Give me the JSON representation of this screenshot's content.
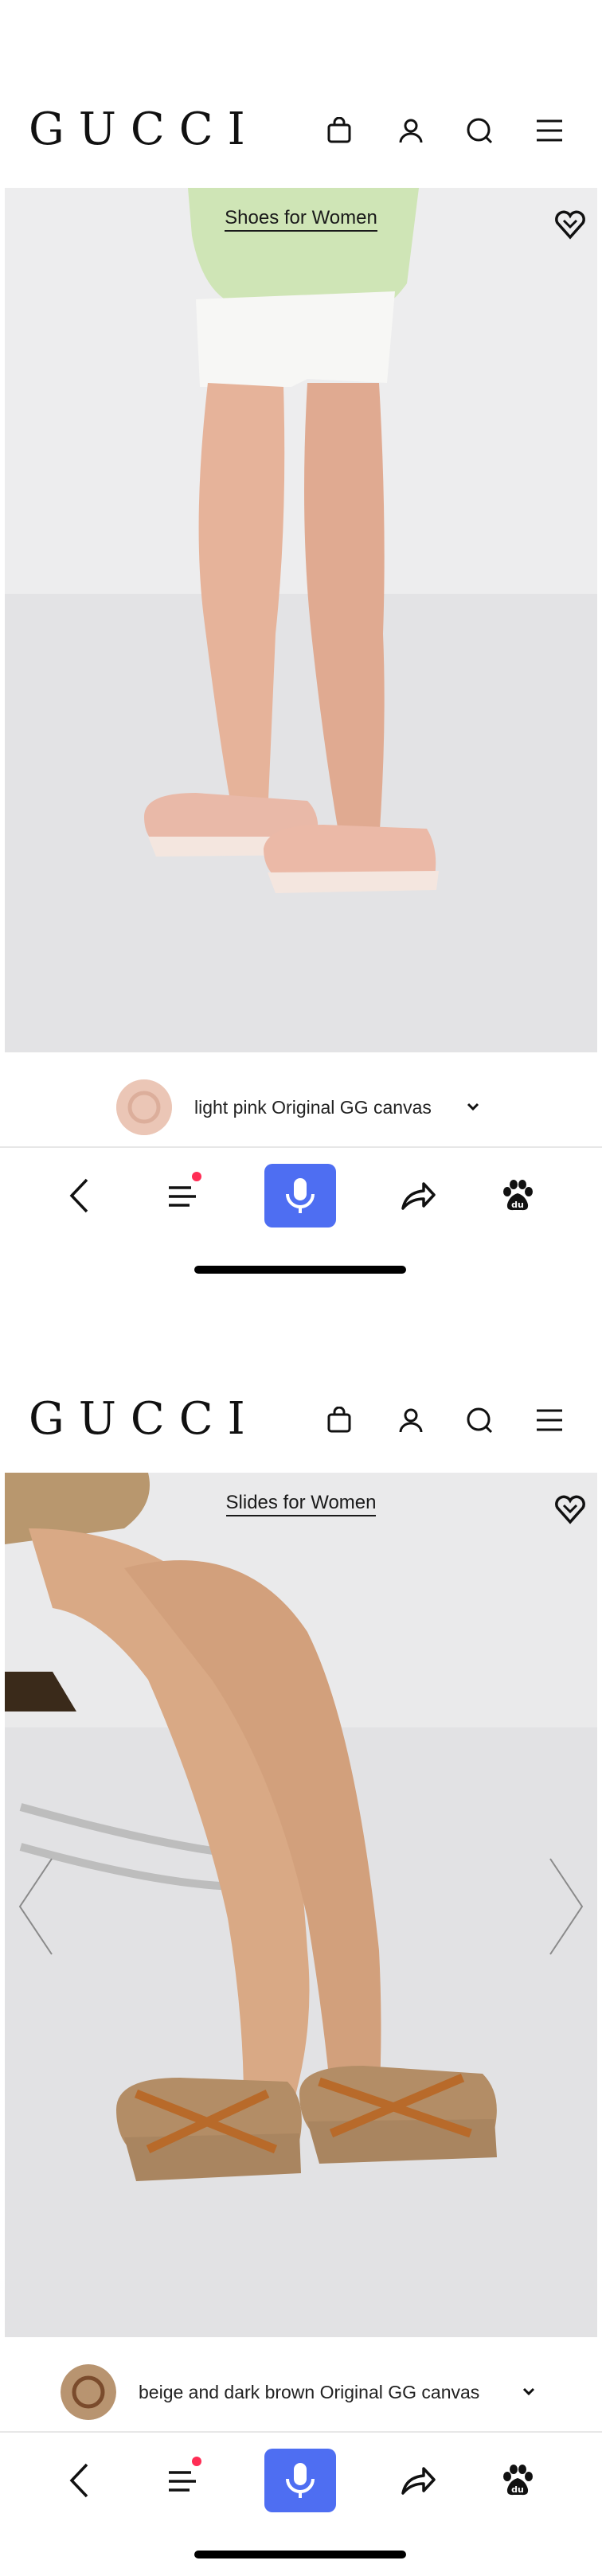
{
  "brand": "GUCCI",
  "accent_color": "#4e6ef2",
  "header_icons": [
    "shopping-bag-icon",
    "account-icon",
    "search-icon",
    "menu-icon"
  ],
  "screens": [
    {
      "breadcrumb": "Shoes for Women",
      "variant": {
        "label": "light pink Original GG canvas",
        "swatch_color": "#e8bfae"
      },
      "photo_bg": "#e9e9ea"
    },
    {
      "breadcrumb": "Slides for Women",
      "variant": {
        "label": "beige and dark brown Original GG canvas",
        "swatch_color": "#b89470"
      },
      "photo_bg": "#e6e6e7"
    }
  ],
  "toolbar": {
    "icons": [
      "back-icon",
      "tabs-menu-icon",
      "microphone-icon",
      "share-icon",
      "baidu-paw-icon"
    ],
    "notification_dot_color": "#ff2d55"
  }
}
